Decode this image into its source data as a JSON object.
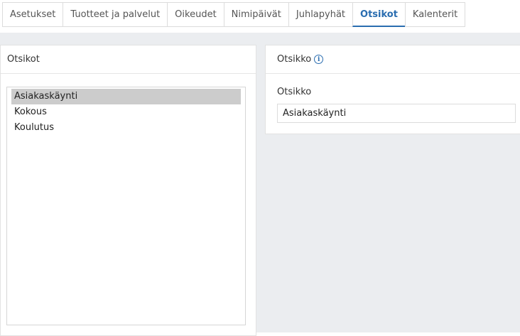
{
  "tabs": [
    {
      "label": "Asetukset",
      "active": false
    },
    {
      "label": "Tuotteet ja palvelut",
      "active": false
    },
    {
      "label": "Oikeudet",
      "active": false
    },
    {
      "label": "Nimipäivät",
      "active": false
    },
    {
      "label": "Juhlapyhät",
      "active": false
    },
    {
      "label": "Otsikot",
      "active": true
    },
    {
      "label": "Kalenterit",
      "active": false
    }
  ],
  "left_panel": {
    "title": "Otsikot",
    "items": [
      "Asiakaskäynti",
      "Kokous",
      "Koulutus"
    ],
    "selected_index": 0
  },
  "right_panel": {
    "title": "Otsikko",
    "info_icon": "info-icon",
    "field_label": "Otsikko",
    "field_value": "Asiakaskäynti"
  },
  "colors": {
    "accent": "#2a6db0",
    "selected_row": "#cccccc",
    "background": "#ebedf0"
  }
}
